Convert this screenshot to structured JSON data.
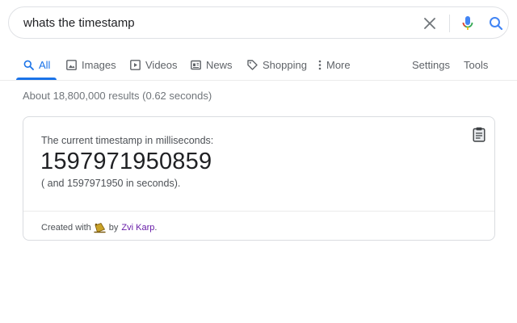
{
  "search": {
    "query": "whats the timestamp",
    "clear_icon": "close-icon",
    "mic_icon": "microphone-icon",
    "search_icon": "search-icon"
  },
  "tabs": [
    {
      "label": "All",
      "icon": "search-icon",
      "active": true
    },
    {
      "label": "Images",
      "icon": "image-icon"
    },
    {
      "label": "Videos",
      "icon": "play-icon"
    },
    {
      "label": "News",
      "icon": "news-icon"
    },
    {
      "label": "Shopping",
      "icon": "tag-icon"
    },
    {
      "label": "More",
      "icon": "more-vert-icon"
    }
  ],
  "tools": {
    "settings": "Settings",
    "tools": "Tools"
  },
  "result_stats": "About 18,800,000 results (0.62 seconds)",
  "card": {
    "label": "The current timestamp in milliseconds:",
    "milliseconds": "1597971950859",
    "seconds_text": "( and 1597971950 in seconds).",
    "copy_icon": "clipboard-icon",
    "credit_prefix": "Created with",
    "credit_by": "by",
    "credit_name": "Zvi Karp",
    "credit_suffix": "."
  },
  "colors": {
    "accent": "#1a73e8",
    "mic_red": "#ea4335",
    "link_visited": "#681da8",
    "muted": "#70757a"
  }
}
